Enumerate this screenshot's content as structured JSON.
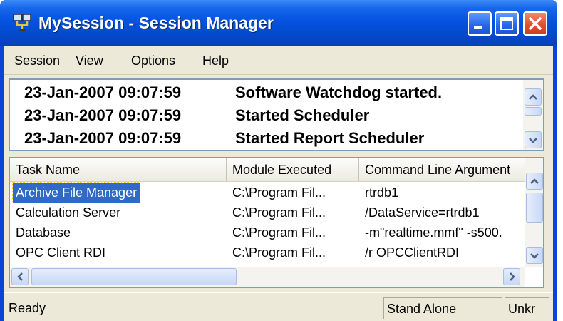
{
  "window": {
    "title": "MySession - Session Manager",
    "icons": {
      "app": "network-computer-icon",
      "minimize": "minimize-icon",
      "maximize": "maximize-icon",
      "close": "close-icon"
    },
    "colors": {
      "titlebar": "#0553e0",
      "close_button": "#e0502f",
      "selection": "#316ac5",
      "face": "#ece9d8"
    }
  },
  "menu": {
    "items": [
      {
        "label": "Session"
      },
      {
        "label": "View"
      },
      {
        "label": "Options"
      },
      {
        "label": "Help"
      }
    ]
  },
  "log": {
    "entries": [
      {
        "timestamp": "23-Jan-2007 09:07:59",
        "message": "Software Watchdog started."
      },
      {
        "timestamp": "23-Jan-2007 09:07:59",
        "message": "Started Scheduler"
      },
      {
        "timestamp": "23-Jan-2007 09:07:59",
        "message": "Started Report Scheduler"
      }
    ]
  },
  "tasks": {
    "columns": [
      {
        "label": "Task Name"
      },
      {
        "label": "Module Executed"
      },
      {
        "label": "Command Line Argument"
      }
    ],
    "rows": [
      {
        "task": "Archive File Manager",
        "module": "C:\\Program Fil...",
        "args": "rtrdb1",
        "selected": true
      },
      {
        "task": "Calculation Server",
        "module": "C:\\Program Fil...",
        "args": "/DataService=rtrdb1",
        "selected": false
      },
      {
        "task": "Database",
        "module": "C:\\Program Fil...",
        "args": "-m\"realtime.mmf\" -s500.",
        "selected": false
      },
      {
        "task": "OPC Client RDI",
        "module": "C:\\Program Fil...",
        "args": "/r OPCClientRDI",
        "selected": false
      }
    ]
  },
  "status": {
    "text": "Ready",
    "mode": "Stand Alone",
    "extra": "Unkr"
  }
}
